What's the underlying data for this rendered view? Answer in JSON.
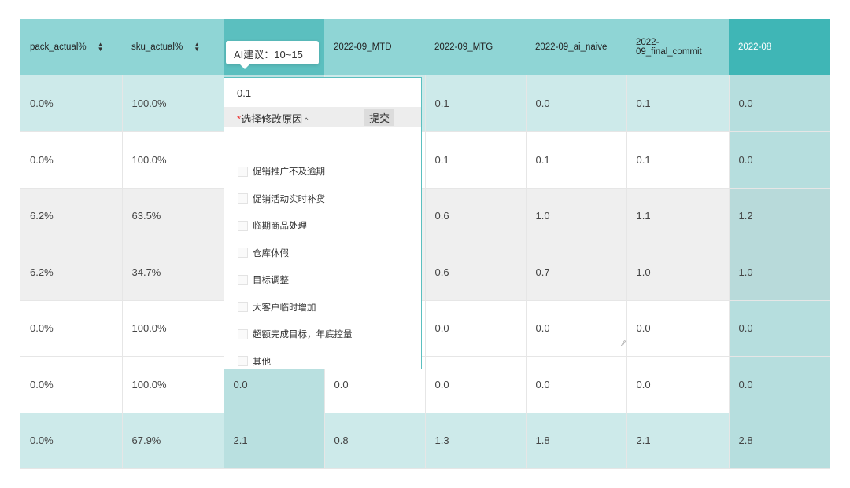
{
  "headers": [
    {
      "label": "pack_actual%",
      "sortable": true
    },
    {
      "label": "sku_actual%",
      "sortable": true
    },
    {
      "label": "",
      "sortable": false
    },
    {
      "label": "2022-09_MTD",
      "sortable": false
    },
    {
      "label": "2022-09_MTG",
      "sortable": false
    },
    {
      "label": "2022-09_ai_naive",
      "sortable": false
    },
    {
      "label": "2022-09_final_commit",
      "sortable": false
    },
    {
      "label": "2022-08",
      "sortable": false
    }
  ],
  "rows": [
    [
      "0.0%",
      "100.0%",
      "",
      "",
      "0.1",
      "0.0",
      "0.1",
      "0.0"
    ],
    [
      "0.0%",
      "100.0%",
      "",
      "",
      "0.1",
      "0.1",
      "0.1",
      "0.0"
    ],
    [
      "6.2%",
      "63.5%",
      "",
      "",
      "0.6",
      "1.0",
      "1.1",
      "1.2"
    ],
    [
      "6.2%",
      "34.7%",
      "",
      "",
      "0.6",
      "0.7",
      "1.0",
      "1.0"
    ],
    [
      "0.0%",
      "100.0%",
      "",
      "",
      "0.0",
      "0.0",
      "0.0",
      "0.0"
    ],
    [
      "0.0%",
      "100.0%",
      "0.0",
      "0.0",
      "0.0",
      "0.0",
      "0.0",
      "0.0"
    ],
    [
      "0.0%",
      "67.9%",
      "2.1",
      "0.8",
      "1.3",
      "1.8",
      "2.1",
      "2.8"
    ]
  ],
  "tooltip": {
    "text": "AI建议：10~15"
  },
  "popover": {
    "value": "0.1",
    "reason_required_mark": "*",
    "reason_label": "选择修改原因",
    "reason_caret": "^",
    "submit_label": "提交",
    "options": [
      "促销推广不及逾期",
      "促销活动实时补货",
      "临期商品处理",
      "仓库休假",
      "目标调整",
      "大客户临时增加",
      "超额完成目标，年底控量",
      "其他"
    ]
  },
  "colors": {
    "header_bg": "#8fd5d5",
    "header_active_bg": "#5bbfbf",
    "header_last_bg": "#3fb6b6",
    "row_teal_bg": "#cdeaea",
    "row_gray_bg": "#efefef",
    "popover_border": "#5bbfbf",
    "required_star": "#e33333"
  }
}
